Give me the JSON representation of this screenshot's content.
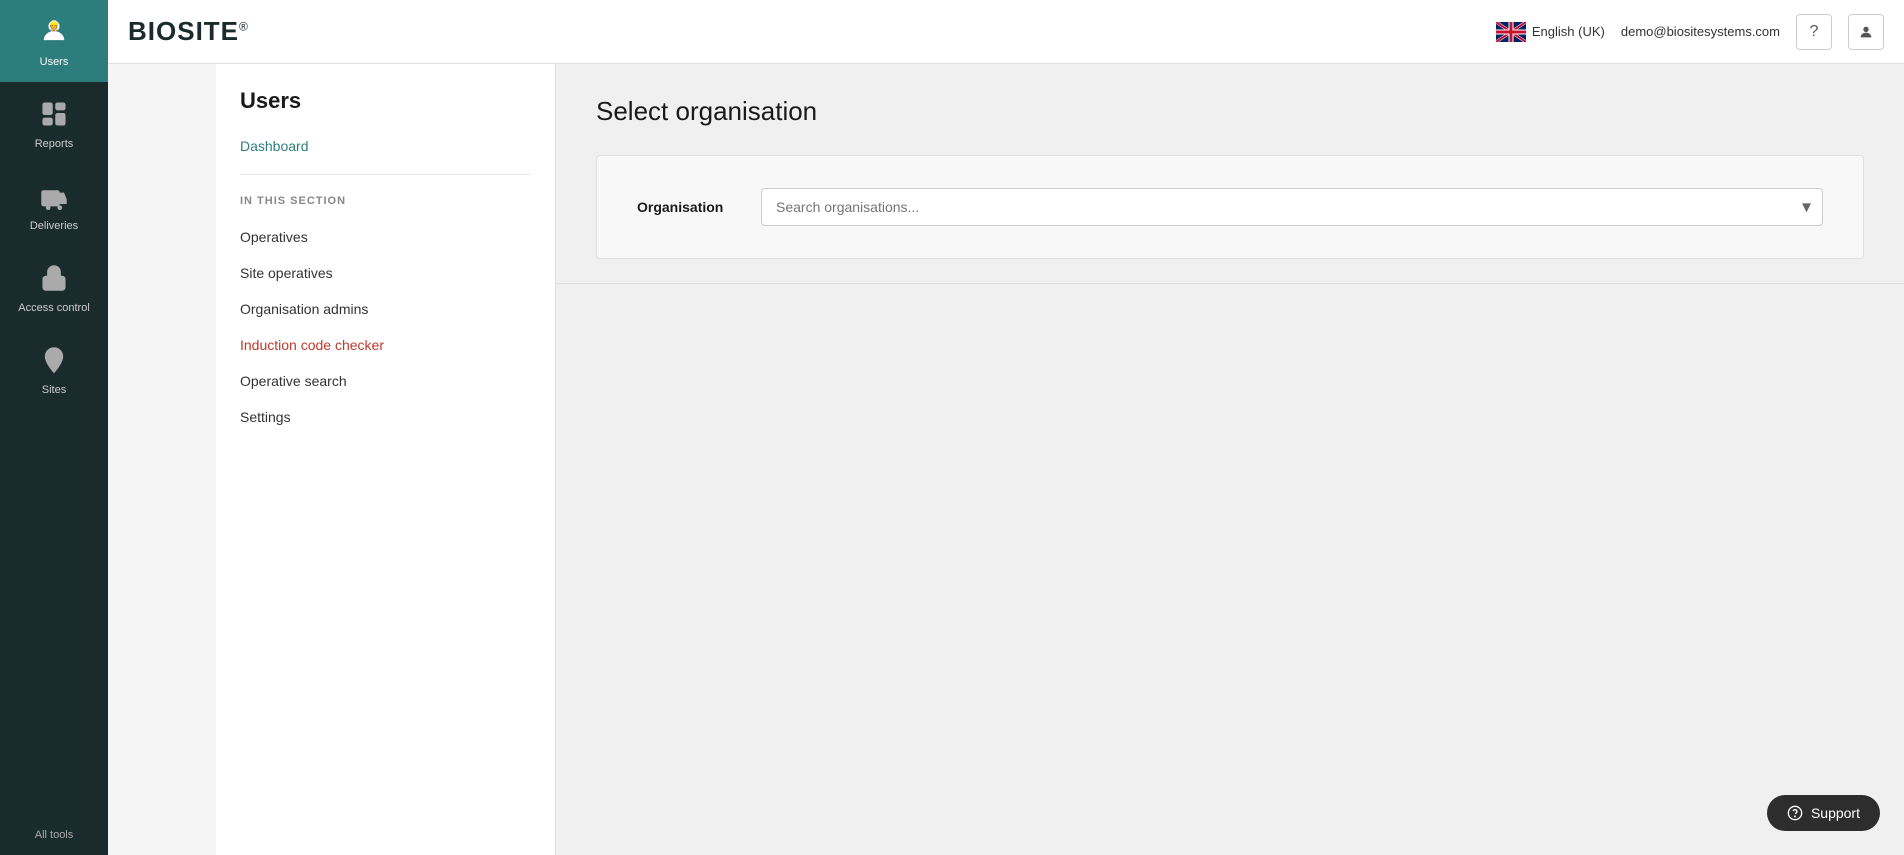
{
  "logo": {
    "text": "BIOSITE",
    "reg_symbol": "®"
  },
  "header": {
    "language": "English (UK)",
    "email": "demo@biositesystems.com",
    "help_label": "?",
    "user_label": "👤"
  },
  "sidebar": {
    "items": [
      {
        "id": "users",
        "label": "Users",
        "icon": "user",
        "active": true
      },
      {
        "id": "reports",
        "label": "Reports",
        "icon": "reports"
      },
      {
        "id": "deliveries",
        "label": "Deliveries",
        "icon": "delivery"
      },
      {
        "id": "access-control",
        "label": "Access control",
        "icon": "access"
      },
      {
        "id": "sites",
        "label": "Sites",
        "icon": "sites"
      }
    ],
    "all_tools_label": "All tools"
  },
  "secondary_sidebar": {
    "title": "Users",
    "dashboard_link": "Dashboard",
    "in_this_section_label": "IN THIS SECTION",
    "nav_items": [
      {
        "id": "operatives",
        "label": "Operatives",
        "active": false
      },
      {
        "id": "site-operatives",
        "label": "Site operatives",
        "active": false
      },
      {
        "id": "organisation-admins",
        "label": "Organisation admins",
        "active": false
      },
      {
        "id": "induction-code-checker",
        "label": "Induction code checker",
        "active": true
      },
      {
        "id": "operative-search",
        "label": "Operative search",
        "active": false
      },
      {
        "id": "settings",
        "label": "Settings",
        "active": false
      }
    ]
  },
  "content": {
    "page_title": "Select organisation",
    "org_label": "Organisation",
    "org_placeholder": "Search organisations..."
  },
  "support": {
    "label": "Support"
  }
}
